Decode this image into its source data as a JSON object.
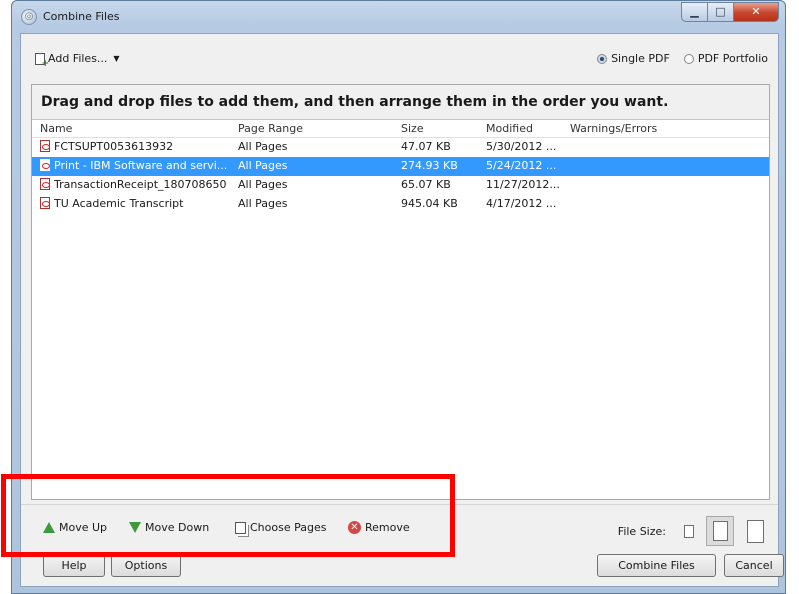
{
  "window": {
    "title": "Combine Files",
    "caption_buttons": {
      "minimize": "▁",
      "maximize": "□",
      "close": "✕"
    }
  },
  "toolbar": {
    "add_files_label": "Add Files...",
    "radio_single_label": "Single PDF",
    "radio_portfolio_label": "PDF Portfolio",
    "selected_mode": "Single PDF"
  },
  "instruction": "Drag and drop files to add them, and then arrange them in the order you want.",
  "list": {
    "columns": [
      "Name",
      "Page Range",
      "Size",
      "Modified",
      "Warnings/Errors"
    ],
    "rows": [
      {
        "name": "FCTSUPT0053613932",
        "range": "All Pages",
        "size": "47.07 KB",
        "modified": "5/30/2012 ...",
        "warnings": ""
      },
      {
        "name": "Print - IBM Software and servi...",
        "range": "All Pages",
        "size": "274.93 KB",
        "modified": "5/24/2012 ...",
        "warnings": ""
      },
      {
        "name": "TransactionReceipt_180708650",
        "range": "All Pages",
        "size": "65.07 KB",
        "modified": "11/27/2012...",
        "warnings": ""
      },
      {
        "name": "TU Academic Transcript",
        "range": "All Pages",
        "size": "945.04 KB",
        "modified": "4/17/2012 ...",
        "warnings": ""
      }
    ],
    "selected_row": 1
  },
  "actions": {
    "move_up": "Move Up",
    "move_down": "Move Down",
    "choose_pages": "Choose Pages",
    "remove": "Remove",
    "remove_glyph": "✕",
    "file_size_label": "File Size:"
  },
  "buttons": {
    "help": "Help",
    "options": "Options",
    "combine": "Combine Files",
    "cancel": "Cancel"
  },
  "colors": {
    "selection": "#3399ff",
    "highlight": "#ff0000",
    "arrow_green": "#3c9a3c",
    "remove_red": "#d64545"
  }
}
